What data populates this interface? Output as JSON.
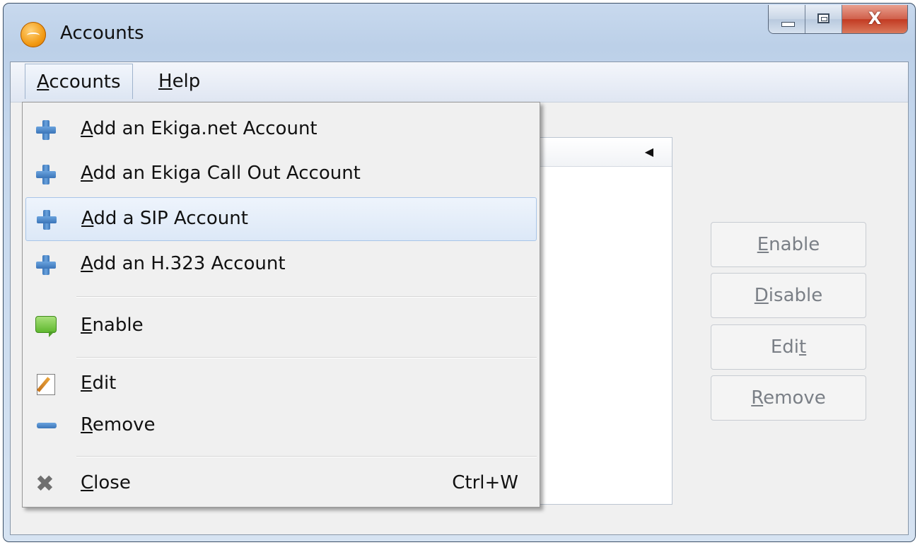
{
  "window": {
    "title": "Accounts",
    "controls": {
      "close_label": "X"
    }
  },
  "menubar": {
    "accounts": {
      "mnemonic": "A",
      "rest": "ccounts"
    },
    "help": {
      "mnemonic": "H",
      "rest": "elp"
    }
  },
  "dropdown": {
    "items": [
      {
        "mnemonic": "A",
        "rest": "dd an Ekiga.net Account",
        "icon": "plus-icon"
      },
      {
        "mnemonic": "A",
        "rest": "dd an Ekiga Call Out Account",
        "icon": "plus-icon"
      },
      {
        "mnemonic": "A",
        "rest": "dd a SIP Account",
        "icon": "plus-icon",
        "highlighted": true
      },
      {
        "mnemonic": "A",
        "rest": "dd an H.323 Account",
        "icon": "plus-icon"
      },
      {
        "mnemonic": "E",
        "rest": "nable",
        "icon": "speech-bubble-icon"
      },
      {
        "mnemonic": "E",
        "rest": "dit",
        "icon": "edit-icon"
      },
      {
        "mnemonic": "R",
        "rest": "emove",
        "icon": "minus-icon"
      },
      {
        "mnemonic": "C",
        "rest": "lose",
        "icon": "close-x-icon",
        "shortcut": "Ctrl+W"
      }
    ]
  },
  "side_buttons": {
    "enable": {
      "mnemonic": "E",
      "rest": "nable"
    },
    "disable": {
      "mnemonic": "D",
      "rest": "isable"
    },
    "edit": {
      "pre": "Edi",
      "mnemonic": "t"
    },
    "remove": {
      "mnemonic": "R",
      "rest": "emove"
    }
  },
  "colors": {
    "menu_highlight": "#dce8f7",
    "plus_icon": "#3b75b8",
    "enable_icon": "#5fb82f",
    "app_icon": "#f29a13",
    "close_button": "#c23a22"
  }
}
